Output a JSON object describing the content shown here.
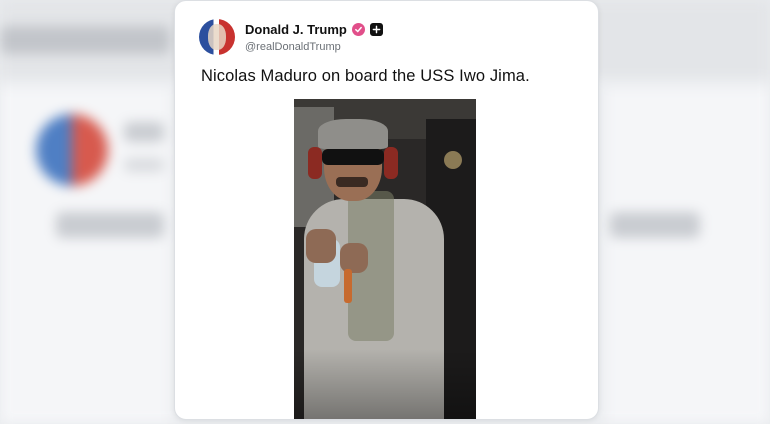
{
  "post": {
    "author_name": "Donald J. Trump",
    "author_handle": "@realDonaldTrump",
    "text": "Nicolas Maduro on board the USS Iwo Jima.",
    "avatar_icon": "profile-avatar",
    "badges": [
      "verified-icon",
      "plus-icon"
    ],
    "photo_subject": "photo"
  },
  "colors": {
    "card_bg": "#ffffff",
    "page_bg": "#e9ebee",
    "verified": "#e14f8a",
    "text": "#111111",
    "handle": "#6b7076"
  }
}
